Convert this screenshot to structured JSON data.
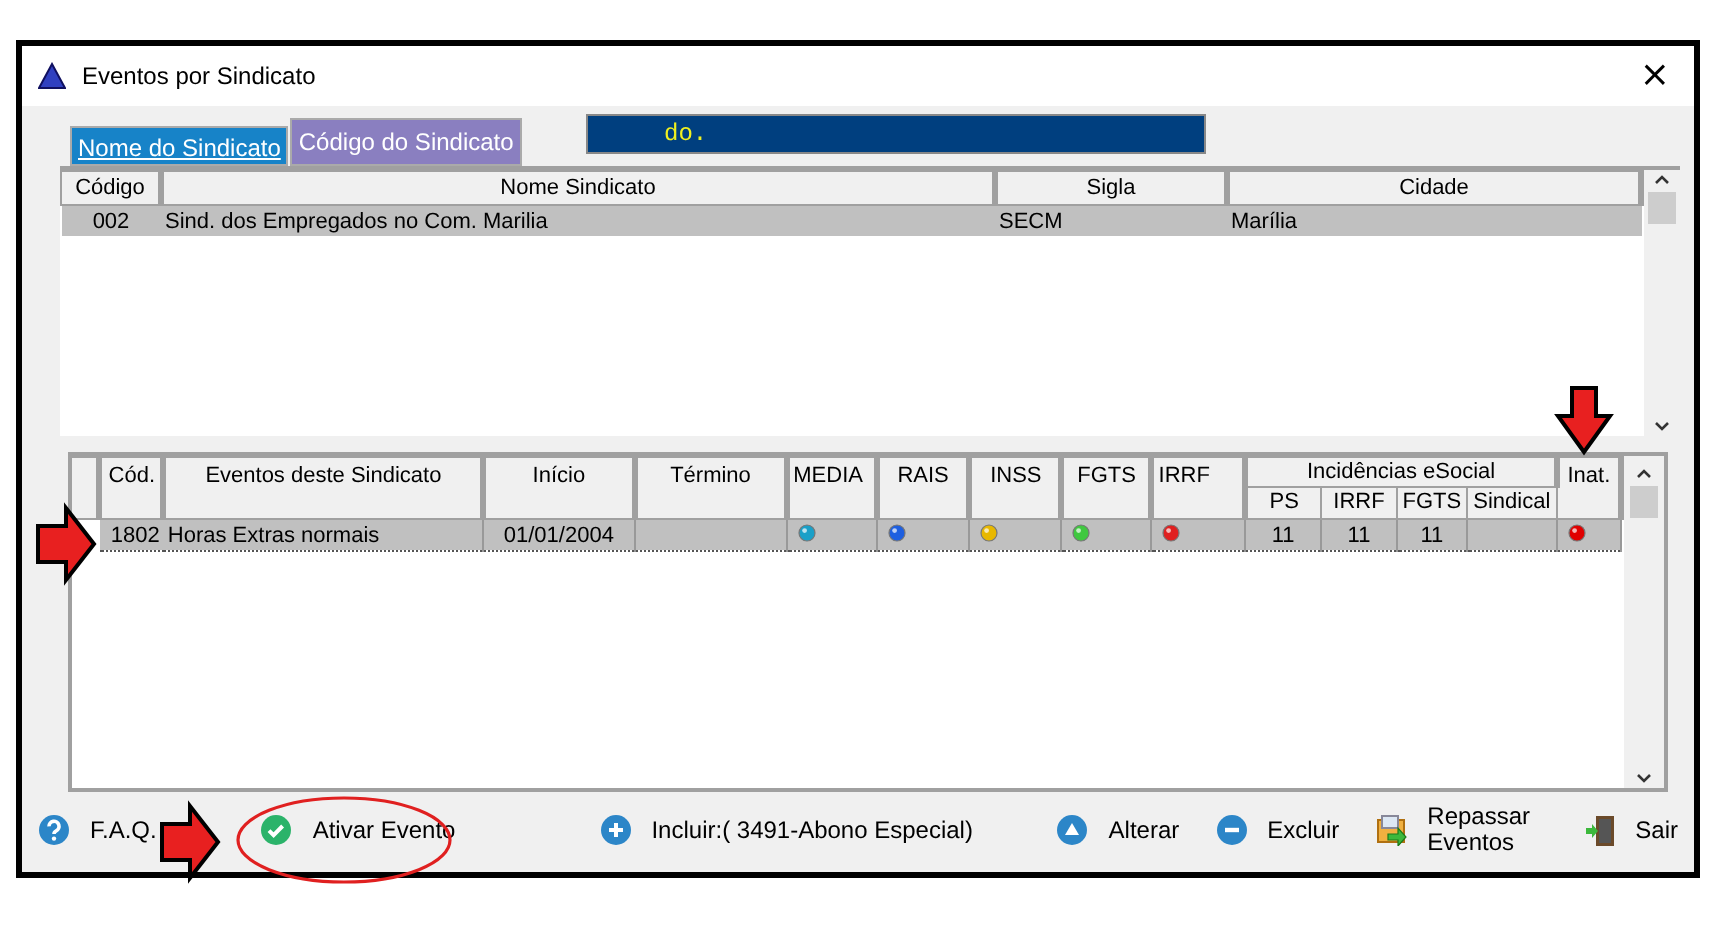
{
  "window": {
    "title": "Eventos por Sindicato",
    "close": "×"
  },
  "tabs": [
    {
      "label": "Nome do Sindicato",
      "selected": false
    },
    {
      "label": "Código do Sindicato",
      "selected": true
    }
  ],
  "search_field": {
    "value": "do."
  },
  "sindicatos": {
    "columns": [
      "Código",
      "Nome Sindicato",
      "Sigla",
      "Cidade"
    ],
    "rows": [
      {
        "cells": [
          "002",
          "Sind. dos Empregados no Com. Marilia",
          "SECM",
          "Marília"
        ],
        "selected": true
      }
    ]
  },
  "eventos": {
    "columns": [
      "Cód.",
      "Eventos deste Sindicato",
      "Início",
      "Término",
      "MEDIA",
      "RAIS",
      "INSS",
      "FGTS",
      "IRRF"
    ],
    "group_header": "Incidências eSocial",
    "group_columns": [
      "PS",
      "IRRF",
      "FGTS",
      "Sindical"
    ],
    "last_column": "Inat.",
    "rows": [
      {
        "selected": true,
        "cod": "1802",
        "evento": "Horas Extras normais",
        "inicio": "01/01/2004",
        "flags": [
          {
            "color": "#1aa0c8"
          },
          {
            "color": "#1e5fe0"
          },
          {
            "color": "#e8b800"
          },
          {
            "color": "#40c840"
          },
          {
            "color": "#e02020"
          }
        ],
        "incidencias": [
          "11",
          "11",
          "11"
        ],
        "inat": {
          "color": "#e00000"
        }
      }
    ]
  },
  "actions": [
    {
      "kind": "help",
      "label": "F.A.Q."
    },
    {
      "kind": "check",
      "label": "Ativar Evento"
    },
    {
      "kind": "plus",
      "label": "Incluir:( 3491-Abono Especial)"
    },
    {
      "kind": "up",
      "label": "Alterar"
    },
    {
      "kind": "minus",
      "label": "Excluir"
    },
    {
      "kind": "transfer",
      "label": "Repassar Eventos"
    },
    {
      "kind": "exit",
      "label": "Sair"
    }
  ],
  "annotations": [
    {
      "kind": "arrow-right"
    },
    {
      "kind": "arrow-down"
    },
    {
      "kind": "arrow-right"
    },
    {
      "kind": "ellipse"
    }
  ]
}
